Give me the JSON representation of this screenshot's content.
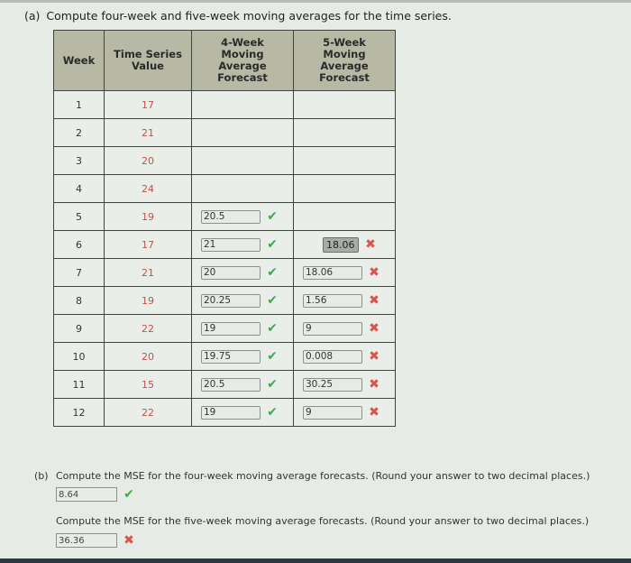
{
  "part_a": {
    "label": "(a)",
    "prompt": "Compute four-week and five-week moving averages for the time series."
  },
  "table": {
    "headers": {
      "week": "Week",
      "ts_line1": "Time Series",
      "ts_line2": "Value",
      "w4_line1": "4-Week",
      "w4_line2": "Moving",
      "w4_line3": "Average",
      "w4_line4": "Forecast",
      "w5_line1": "5-Week",
      "w5_line2": "Moving",
      "w5_line3": "Average",
      "w5_line4": "Forecast"
    },
    "rows": [
      {
        "week": "1",
        "value": "17"
      },
      {
        "week": "2",
        "value": "21"
      },
      {
        "week": "3",
        "value": "20"
      },
      {
        "week": "4",
        "value": "24"
      },
      {
        "week": "5",
        "value": "19",
        "w4": "20.5",
        "w4_status": "correct"
      },
      {
        "week": "6",
        "value": "17",
        "w4": "21",
        "w4_status": "correct",
        "w5": "18.06",
        "w5_status": "incorrect"
      },
      {
        "week": "7",
        "value": "21",
        "w4": "20",
        "w4_status": "correct",
        "w5": "18.06",
        "w5_status": "incorrect"
      },
      {
        "week": "8",
        "value": "19",
        "w4": "20.25",
        "w4_status": "correct",
        "w5": "1.56",
        "w5_status": "incorrect"
      },
      {
        "week": "9",
        "value": "22",
        "w4": "19",
        "w4_status": "correct",
        "w5": "9",
        "w5_status": "incorrect"
      },
      {
        "week": "10",
        "value": "20",
        "w4": "19.75",
        "w4_status": "correct",
        "w5": "0.008",
        "w5_status": "incorrect"
      },
      {
        "week": "11",
        "value": "15",
        "w4": "20.5",
        "w4_status": "correct",
        "w5": "30.25",
        "w5_status": "incorrect"
      },
      {
        "week": "12",
        "value": "22",
        "w4": "19",
        "w4_status": "correct",
        "w5": "9",
        "w5_status": "incorrect"
      }
    ]
  },
  "part_b": {
    "label": "(b)",
    "prompt_4w": "Compute the MSE for the four-week moving average forecasts. (Round your answer to two decimal places.)",
    "answer_4w": "8.64",
    "status_4w": "correct",
    "prompt_5w": "Compute the MSE for the five-week moving average forecasts. (Round your answer to two decimal places.)",
    "answer_5w": "36.36",
    "status_5w": "incorrect"
  },
  "icons": {
    "check": "✔",
    "cross": "✖"
  },
  "colors": {
    "correct": "#3faa4a",
    "incorrect": "#d9534f",
    "header_bg": "#b8b9a5",
    "series_value": "#c4504a"
  }
}
